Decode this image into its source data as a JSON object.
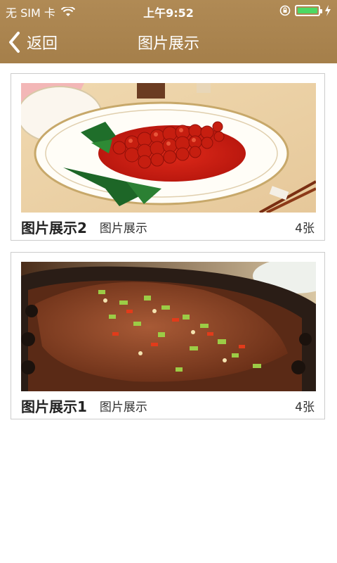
{
  "status_bar": {
    "carrier": "无 SIM 卡",
    "time": "上午9:52",
    "icons": [
      "wifi-icon",
      "rotation-lock-icon",
      "battery-icon",
      "charging-bolt-icon"
    ]
  },
  "nav": {
    "back_label": "返回",
    "title": "图片展示",
    "background_color": "#a57f4a"
  },
  "gallery": [
    {
      "title": "图片展示2",
      "subtitle": "图片展示",
      "count": "4张",
      "image": "sweet-sour-fish-dish"
    },
    {
      "title": "图片展示1",
      "subtitle": "图片展示",
      "count": "4张",
      "image": "braised-fish-with-scallions"
    }
  ]
}
